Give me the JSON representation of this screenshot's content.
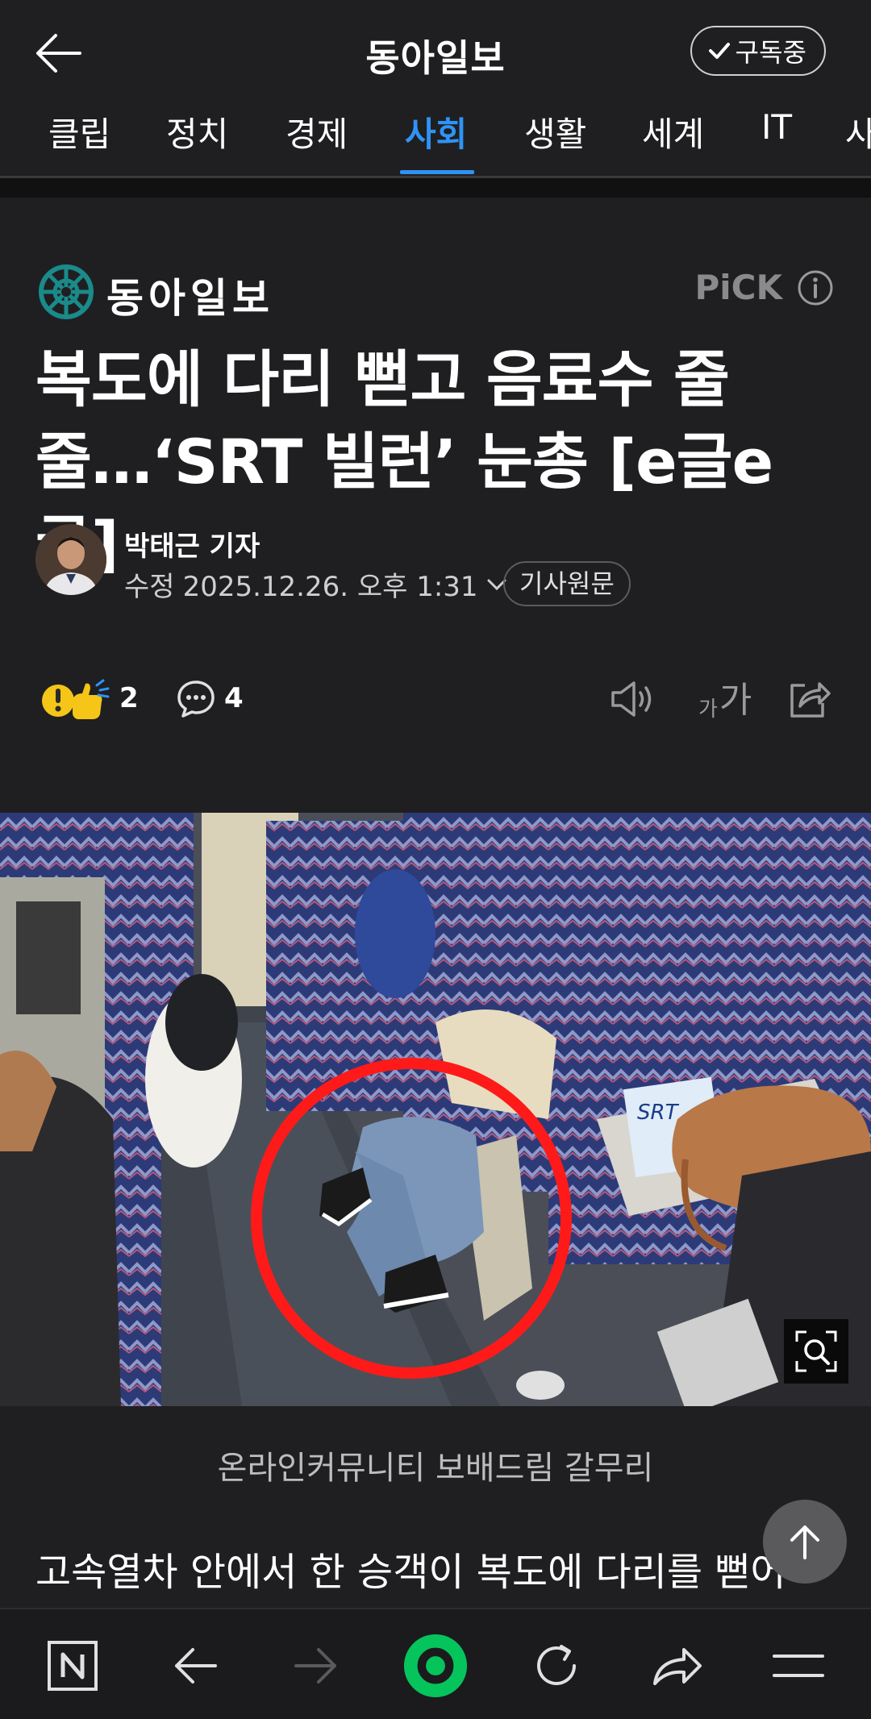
{
  "header": {
    "title": "동아일보",
    "subscribe_label": "구독중",
    "tabs": [
      {
        "label": "클립",
        "active": false
      },
      {
        "label": "정치",
        "active": false
      },
      {
        "label": "경제",
        "active": false
      },
      {
        "label": "사회",
        "active": true
      },
      {
        "label": "생활",
        "active": false
      },
      {
        "label": "세계",
        "active": false
      },
      {
        "label": "IT",
        "active": false
      },
      {
        "label": "사",
        "active": false
      }
    ]
  },
  "article": {
    "press_name": "동아일보",
    "pick_label": "PiCK",
    "headline_line1": "복도에 다리 뻗고 음료수 줄",
    "headline_line2": "줄…‘SRT 빌런’ 눈총 [e글e글]",
    "reporter": "박태근 기자",
    "modified_label": "수정",
    "modified_date": "2025.12.26. 오후 1:31",
    "original_label": "기사원문",
    "reaction_count": "2",
    "comment_count": "4",
    "font_small": "가",
    "font_big": "가",
    "photo_caption": "온라인커뮤니티 보배드림 갈무리",
    "photo_logo_text": "SRT",
    "body_first_line": "고속열차 안에서 한 승객이 복도에 다리를 뻗어"
  },
  "colors": {
    "background": "#1f1f21",
    "accent": "#2f93f6",
    "press_logo": "#1a8a8a",
    "nav_green": "#06c45c",
    "circle_red": "#ff1a1a"
  },
  "icons": {
    "back": "arrow-left-icon",
    "subscribe": "check-icon",
    "info": "info-icon",
    "reaction": "reaction-emoji-icon",
    "comment": "comment-icon",
    "tts": "speaker-icon",
    "share": "share-icon",
    "zoom": "zoom-icon",
    "scroll_top": "arrow-up-icon",
    "nav": [
      "naver-n-icon",
      "back-arrow-icon",
      "forward-arrow-icon",
      "green-dot-icon",
      "refresh-icon",
      "share-arrow-icon",
      "menu-icon"
    ]
  }
}
